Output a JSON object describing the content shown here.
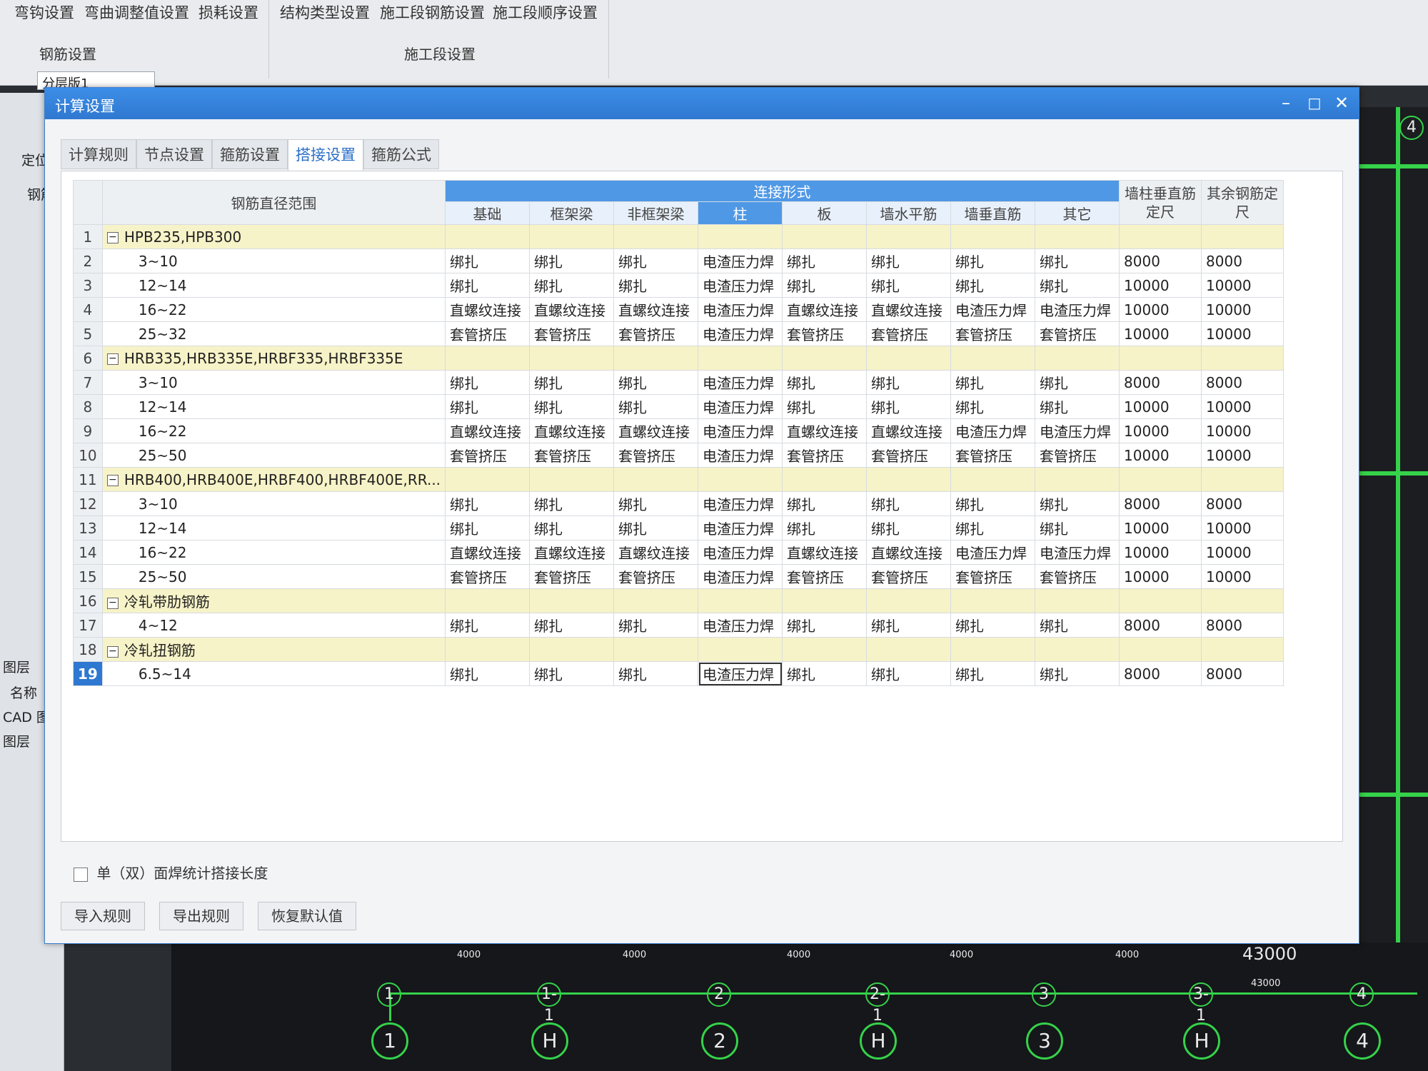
{
  "ribbon": {
    "items": [
      "弯钩设置",
      "弯曲调整值设置",
      "损耗设置",
      "结构类型设置",
      "施工段钢筋设置",
      "施工段顺序设置"
    ],
    "groups": [
      "钢筋设置",
      "施工段设置"
    ],
    "layer_select": "分层版1"
  },
  "left_panel": {
    "items": [
      "定位",
      "钢筋",
      "图层",
      "名称",
      "CAD 图层",
      "图层"
    ]
  },
  "dialog": {
    "title": "计算设置",
    "tabs": [
      "计算规则",
      "节点设置",
      "箍筋设置",
      "搭接设置",
      "箍筋公式"
    ],
    "active_tab": "搭接设置",
    "grid": {
      "header_range": "钢筋直径范围",
      "header_group": "连接形式",
      "sub_headers": [
        "基础",
        "框架梁",
        "非框架梁",
        "柱",
        "板",
        "墙水平筋",
        "墙垂直筋",
        "其它"
      ],
      "header_col_length": "墙柱垂直筋定尺",
      "header_other_length": "其余钢筋定尺",
      "rows": [
        {
          "n": "1",
          "group": true,
          "label": "HPB235,HPB300"
        },
        {
          "n": "2",
          "label": "3~10",
          "cells": [
            "绑扎",
            "绑扎",
            "绑扎",
            "电渣压力焊",
            "绑扎",
            "绑扎",
            "绑扎",
            "绑扎",
            "8000",
            "8000"
          ]
        },
        {
          "n": "3",
          "label": "12~14",
          "cells": [
            "绑扎",
            "绑扎",
            "绑扎",
            "电渣压力焊",
            "绑扎",
            "绑扎",
            "绑扎",
            "绑扎",
            "10000",
            "10000"
          ]
        },
        {
          "n": "4",
          "label": "16~22",
          "cells": [
            "直螺纹连接",
            "直螺纹连接",
            "直螺纹连接",
            "电渣压力焊",
            "直螺纹连接",
            "直螺纹连接",
            "电渣压力焊",
            "电渣压力焊",
            "10000",
            "10000"
          ]
        },
        {
          "n": "5",
          "label": "25~32",
          "cells": [
            "套管挤压",
            "套管挤压",
            "套管挤压",
            "电渣压力焊",
            "套管挤压",
            "套管挤压",
            "套管挤压",
            "套管挤压",
            "10000",
            "10000"
          ]
        },
        {
          "n": "6",
          "group": true,
          "label": "HRB335,HRB335E,HRBF335,HRBF335E"
        },
        {
          "n": "7",
          "label": "3~10",
          "cells": [
            "绑扎",
            "绑扎",
            "绑扎",
            "电渣压力焊",
            "绑扎",
            "绑扎",
            "绑扎",
            "绑扎",
            "8000",
            "8000"
          ]
        },
        {
          "n": "8",
          "label": "12~14",
          "cells": [
            "绑扎",
            "绑扎",
            "绑扎",
            "电渣压力焊",
            "绑扎",
            "绑扎",
            "绑扎",
            "绑扎",
            "10000",
            "10000"
          ]
        },
        {
          "n": "9",
          "label": "16~22",
          "cells": [
            "直螺纹连接",
            "直螺纹连接",
            "直螺纹连接",
            "电渣压力焊",
            "直螺纹连接",
            "直螺纹连接",
            "电渣压力焊",
            "电渣压力焊",
            "10000",
            "10000"
          ]
        },
        {
          "n": "10",
          "label": "25~50",
          "cells": [
            "套管挤压",
            "套管挤压",
            "套管挤压",
            "电渣压力焊",
            "套管挤压",
            "套管挤压",
            "套管挤压",
            "套管挤压",
            "10000",
            "10000"
          ]
        },
        {
          "n": "11",
          "group": true,
          "label": "HRB400,HRB400E,HRBF400,HRBF400E,RR..."
        },
        {
          "n": "12",
          "label": "3~10",
          "cells": [
            "绑扎",
            "绑扎",
            "绑扎",
            "电渣压力焊",
            "绑扎",
            "绑扎",
            "绑扎",
            "绑扎",
            "8000",
            "8000"
          ]
        },
        {
          "n": "13",
          "label": "12~14",
          "cells": [
            "绑扎",
            "绑扎",
            "绑扎",
            "电渣压力焊",
            "绑扎",
            "绑扎",
            "绑扎",
            "绑扎",
            "10000",
            "10000"
          ]
        },
        {
          "n": "14",
          "label": "16~22",
          "cells": [
            "直螺纹连接",
            "直螺纹连接",
            "直螺纹连接",
            "电渣压力焊",
            "直螺纹连接",
            "直螺纹连接",
            "电渣压力焊",
            "电渣压力焊",
            "10000",
            "10000"
          ]
        },
        {
          "n": "15",
          "label": "25~50",
          "cells": [
            "套管挤压",
            "套管挤压",
            "套管挤压",
            "电渣压力焊",
            "套管挤压",
            "套管挤压",
            "套管挤压",
            "套管挤压",
            "10000",
            "10000"
          ]
        },
        {
          "n": "16",
          "group": true,
          "label": "冷轧带肋钢筋"
        },
        {
          "n": "17",
          "label": "4~12",
          "cells": [
            "绑扎",
            "绑扎",
            "绑扎",
            "电渣压力焊",
            "绑扎",
            "绑扎",
            "绑扎",
            "绑扎",
            "8000",
            "8000"
          ]
        },
        {
          "n": "18",
          "group": true,
          "label": "冷轧扭钢筋"
        },
        {
          "n": "19",
          "label": "6.5~14",
          "selected": true,
          "cells": [
            "绑扎",
            "绑扎",
            "绑扎",
            "电渣压力焊",
            "绑扎",
            "绑扎",
            "绑扎",
            "绑扎",
            "8000",
            "8000"
          ]
        }
      ]
    },
    "checkbox_label": "单（双）面焊统计搭接长度",
    "buttons": [
      "导入规则",
      "导出规则",
      "恢复默认值"
    ]
  },
  "cad": {
    "axis_top": [
      "1",
      "1-1",
      "2",
      "2-1",
      "3",
      "3-1",
      "4"
    ],
    "axis_bottom": [
      "1",
      "H",
      "2",
      "H",
      "3",
      "H",
      "4"
    ],
    "dims": [
      "4000",
      "4000",
      "4000",
      "4000",
      "4000"
    ],
    "total": "43000",
    "total_small": "43000",
    "corner_axis": "4"
  },
  "colors": {
    "accent": "#2f78d1",
    "group_row": "#f7f3c8",
    "grid_line": "#35d24a"
  }
}
